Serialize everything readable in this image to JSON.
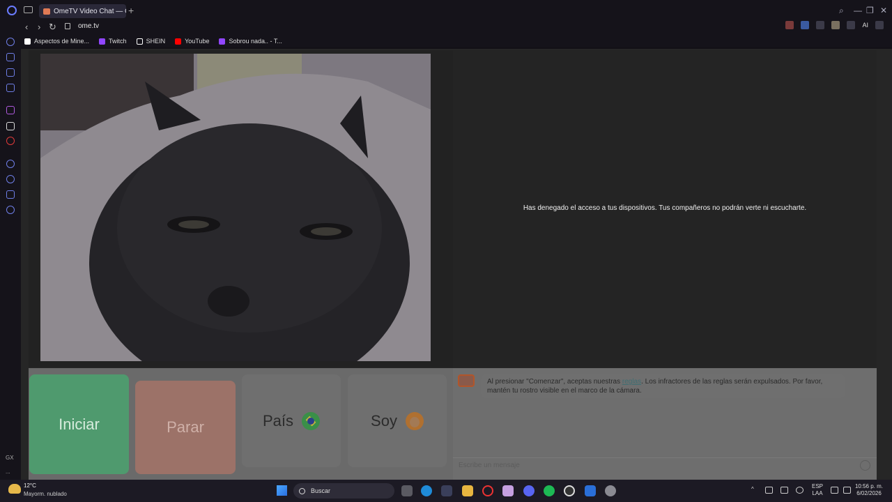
{
  "browser": {
    "tab_title": "OmeTV Video Chat — Ome",
    "url": "ome.tv",
    "new_tab": "+",
    "back": "‹",
    "forward": "›",
    "reload": "↻",
    "ai_label": "AI",
    "minimize": "—",
    "maximize": "❐",
    "close": "✕"
  },
  "bookmarks": [
    {
      "label": "Aspectos de Mine...",
      "icon": "notion-icon",
      "color": "#ffffff"
    },
    {
      "label": "Twitch",
      "icon": "twitch-icon",
      "color": "#9146ff"
    },
    {
      "label": "SHEIN",
      "icon": "shein-icon",
      "color": "#ffffff"
    },
    {
      "label": "YouTube",
      "icon": "youtube-icon",
      "color": "#ff0000"
    },
    {
      "label": "Sobrou nada.. - T...",
      "icon": "twitch-icon",
      "color": "#9146ff"
    }
  ],
  "sidebar": {
    "gx_label": "GX",
    "more_label": "..."
  },
  "page": {
    "notice": "Has denegado el acceso a tus dispositivos. Tus compañeros no podrán verte ni escucharte.",
    "start_label": "Iniciar",
    "stop_label": "Parar",
    "country_label": "País",
    "gender_label": "Soy",
    "chat_before_link": "Al presionar \"Comenzar\", aceptas nuestras ",
    "chat_link": "reglas",
    "chat_after_link": ". Los infractores de las reglas serán expulsados. Por favor, mantén tu rostro visible en el marco de la cámara.",
    "chat_placeholder": "Escribe un mensaje",
    "chat_logo_text": "Ome TV"
  },
  "taskbar": {
    "temperature": "12°C",
    "weather": "Mayorm. nublado",
    "search_label": "Buscar",
    "lang_top": "ESP",
    "lang_bottom": "LAA",
    "time": "10:56 p. m.",
    "date": "6/02/2026"
  },
  "colors": {
    "start_button": "#4f9a6e",
    "stop_button": "#9c7268",
    "accent": "#6b7cff"
  }
}
